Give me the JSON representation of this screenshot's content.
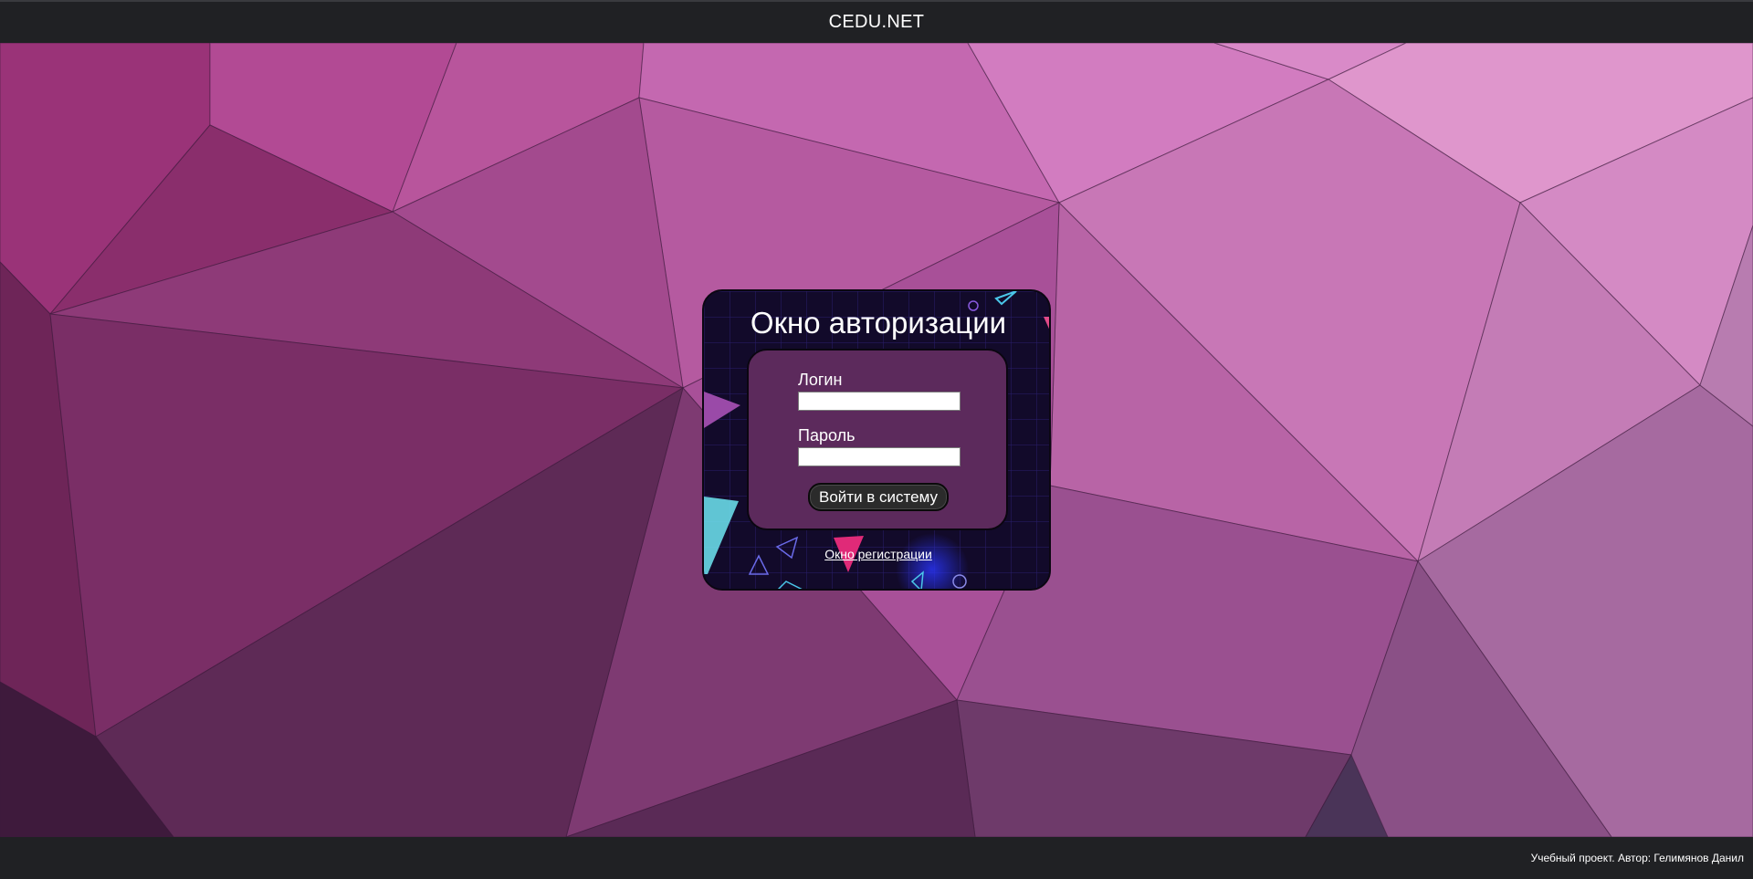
{
  "header": {
    "site_title": "CEDU.NET"
  },
  "auth_card": {
    "title": "Окно авторизации",
    "login_label": "Логин",
    "login_value": "",
    "password_label": "Пароль",
    "password_value": "",
    "submit_label": "Войти в систему",
    "register_link": "Окно регистрации"
  },
  "footer": {
    "text": "Учебный проект. Автор: Гелимянов Данил"
  },
  "colors": {
    "bar": "#202124",
    "form_box": "#5c2a5c",
    "button": "#2b2b2b",
    "background_accent": "#c468b0"
  }
}
